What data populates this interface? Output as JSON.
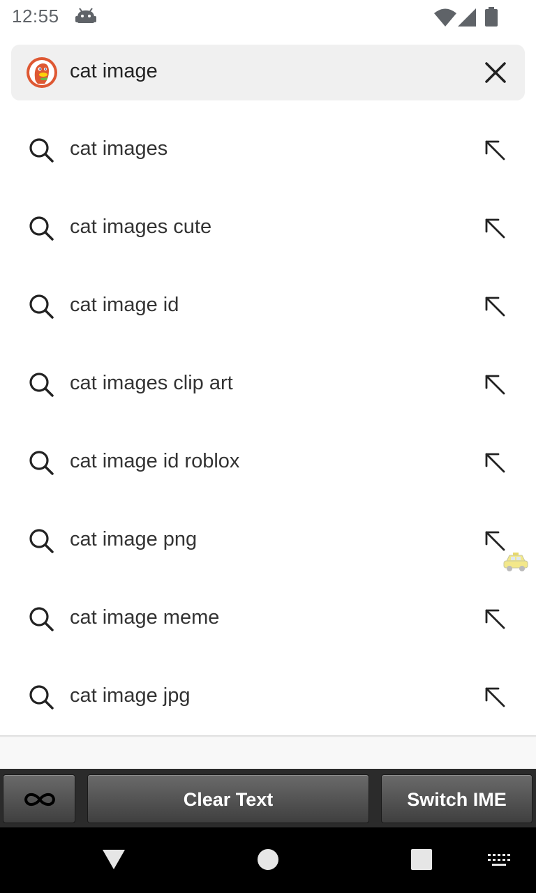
{
  "status_bar": {
    "time": "12:55",
    "icons": [
      "android-robot-icon",
      "wifi-icon",
      "signal-icon",
      "battery-icon"
    ]
  },
  "search": {
    "query": "cat image",
    "logo": "duckduckgo-logo",
    "clear_icon": "close-icon"
  },
  "suggestions": [
    {
      "label": "cat images"
    },
    {
      "label": "cat images cute"
    },
    {
      "label": "cat image id"
    },
    {
      "label": "cat images clip art"
    },
    {
      "label": "cat image id roblox"
    },
    {
      "label": "cat image png"
    },
    {
      "label": "cat image meme"
    },
    {
      "label": "cat image jpg"
    }
  ],
  "ime_toolbar": {
    "infinity_icon": "infinity-icon",
    "clear_text_label": "Clear Text",
    "switch_ime_label": "Switch IME"
  },
  "nav_bar": {
    "icons": [
      "back-icon",
      "home-icon",
      "recents-icon",
      "keyboard-icon"
    ]
  },
  "colors": {
    "search_bar_bg": "#f0f0f0",
    "ddg_orange": "#de5833",
    "ime_bar_bg": "#2b2b2b",
    "nav_bar_bg": "#000000",
    "icon_gray": "#5f6368"
  }
}
